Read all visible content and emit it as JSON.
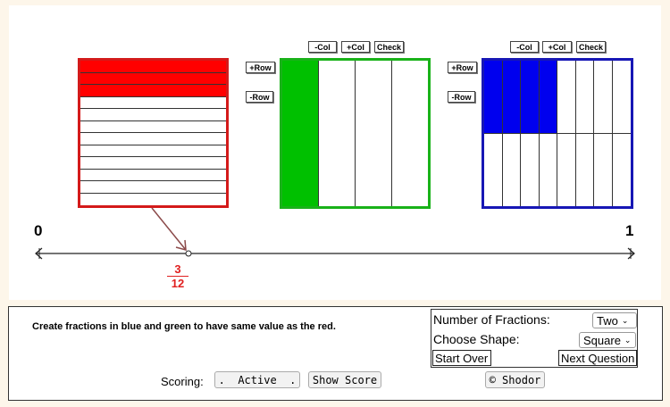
{
  "grid_controls": {
    "add_row": "+Row",
    "remove_row": "-Row",
    "remove_col": "-Col",
    "add_col": "+Col",
    "check": "Check"
  },
  "red_fraction": {
    "rows_total": 12,
    "rows_filled": 3,
    "color": "#ff0000",
    "border_color": "#d41a1a"
  },
  "green_fraction": {
    "cols_total": 4,
    "cols_filled": 1,
    "color": "#00c000",
    "border_color": "#19b219"
  },
  "blue_fraction": {
    "cols_total": 8,
    "rows_total": 2,
    "filled_top_cols": 4,
    "color": "#0000ee",
    "border_color": "#1717b5"
  },
  "number_line": {
    "start_label": "0",
    "end_label": "1",
    "marker_numerator": "3",
    "marker_denominator": "12",
    "marker_value": 0.25
  },
  "panel": {
    "instructions": "Create fractions in blue and green to have same value as the red.",
    "num_fractions_label": "Number of Fractions:",
    "num_fractions_value": "Two",
    "shape_label": "Choose Shape:",
    "shape_value": "Square",
    "start_over": "Start Over",
    "next_question": "Next Question",
    "scoring_label": "Scoring:",
    "active_button": ".  Active  .",
    "show_score": "Show Score",
    "shodor": "© Shodor"
  }
}
